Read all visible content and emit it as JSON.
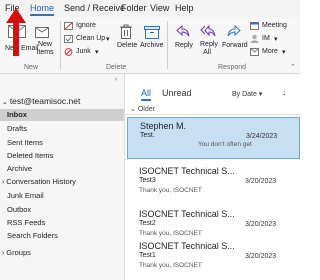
{
  "menubar": {
    "items": [
      "File",
      "Home",
      "Send / Receive",
      "Folder",
      "View",
      "Help"
    ],
    "active": "Home"
  },
  "ribbon": {
    "new_email_label": "New Email",
    "new_items_label": "New Items",
    "group_new": "New",
    "ignore_label": "Ignore",
    "cleanup_label": "Clean Up",
    "junk_label": "Junk",
    "delete_label": "Delete",
    "archive_label": "Archive",
    "group_delete": "Delete",
    "reply_label": "Reply",
    "reply_all_label": "Reply All",
    "forward_label": "Forward",
    "meeting_label": "Meeting",
    "im_label": "IM",
    "more_label": "More",
    "group_respond": "Respond"
  },
  "navpane": {
    "account": "test@teamisoc.net",
    "folders": [
      "Inbox",
      "Drafts",
      "Sent Items",
      "Deleted Items",
      "Archive",
      "Conversation History",
      "Junk Email",
      "Outbox",
      "RSS Feeds",
      "Search Folders"
    ],
    "selected": "Inbox",
    "groups_label": "Groups"
  },
  "maillist": {
    "tab_all": "All",
    "tab_unread": "Unread",
    "sort_label": "By Date",
    "section_label": "Older",
    "messages": [
      {
        "from": "Stephen M.",
        "subject": "Test.",
        "preview": "",
        "note": "You don't often get",
        "date": "3/24/2023",
        "selected": true
      },
      {
        "from": "ISOCNET Technical S...",
        "subject": "Test3",
        "preview": "Thank you, ISOCNET",
        "date": "3/20/2023",
        "selected": false
      },
      {
        "from": "ISOCNET Technical S...",
        "subject": "Test2",
        "preview": "Thank you, ISOCNET",
        "date": "3/20/2023",
        "selected": false
      },
      {
        "from": "ISOCNET Technical S...",
        "subject": "Test1",
        "preview": "Thank you, ISOCNET",
        "date": "3/20/2023",
        "selected": false
      }
    ]
  },
  "colors": {
    "accent": "#2f72c8",
    "arrow": "#d10f0f",
    "selected_row": "#c7dff3"
  }
}
